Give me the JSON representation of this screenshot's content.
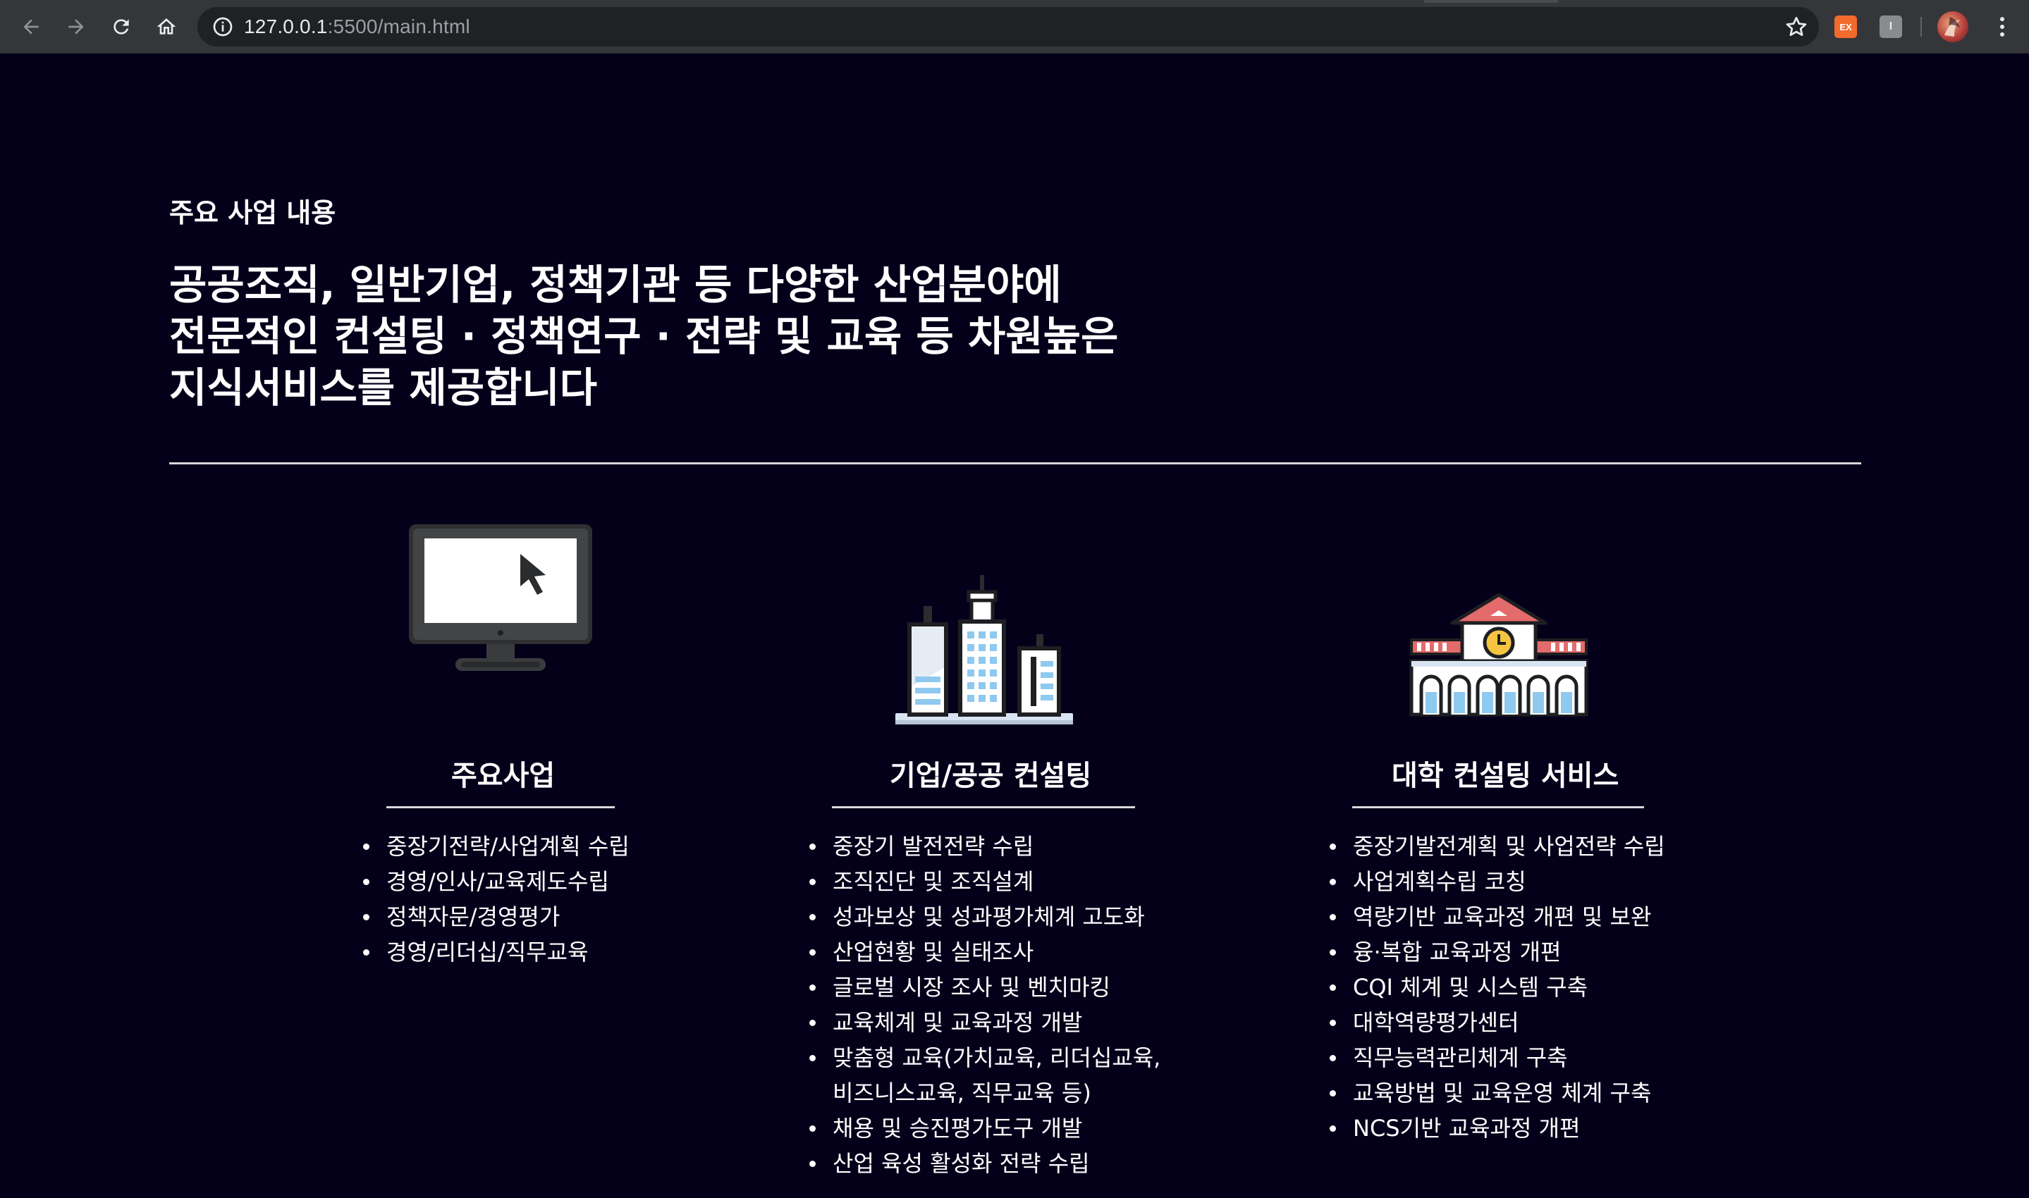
{
  "browser": {
    "url_host": "127.0.0.1",
    "url_path": ":5500/main.html",
    "extensions": [
      {
        "name": "ex-extension",
        "label": "EX",
        "color": "#f26a2c"
      },
      {
        "name": "i-extension",
        "label": "I",
        "color": "#8a8b8f"
      }
    ]
  },
  "page": {
    "section_label": "주요 사업 내용",
    "headline_lines": [
      "공공조직, 일반기업, 정책기관 등 다양한 산업분야에",
      "전문적인 컨설팅 · 정책연구 · 전략 및 교육 등 차원높은",
      "지식서비스를 제공합니다"
    ],
    "columns": [
      {
        "title": "주요사업",
        "icon": "monitor-cursor-icon",
        "items": [
          "중장기전략/사업계획 수립",
          "경영/인사/교육제도수립",
          "정책자문/경영평가",
          "경영/리더십/직무교육"
        ]
      },
      {
        "title": "기업/공공 컨설팅",
        "icon": "city-buildings-icon",
        "items": [
          "중장기 발전전략 수립",
          "조직진단 및 조직설계",
          "성과보상 및 성과평가체계 고도화",
          "산업현황 및 실태조사",
          "글로벌 시장 조사 및 벤치마킹",
          "교육체계 및 교육과정 개발",
          "맞춤형 교육(가치교육, 리더십교육,",
          "비즈니스교육, 직무교육 등)",
          "채용 및 승진평가도구 개발",
          "산업 육성 활성화 전략 수립"
        ]
      },
      {
        "title": "대학 컨설팅 서비스",
        "icon": "university-building-icon",
        "items": [
          "중장기발전계획 및 사업전략 수립",
          "사업계획수립 코칭",
          "역량기반 교육과정 개편 및 보완",
          "융·복합 교육과정 개편",
          "CQI 체계 및 시스템 구축",
          "대학역량평가센터",
          "직무능력관리체계 구축",
          "교육방법 및 교육운영 체계 구축",
          "NCS기반 교육과정 개편"
        ]
      }
    ]
  },
  "colors": {
    "page_bg": "#05001a",
    "chrome_bg": "#35363a",
    "omnibox_bg": "#202124",
    "text": "#ffffff",
    "rule": "#d7d7de"
  }
}
